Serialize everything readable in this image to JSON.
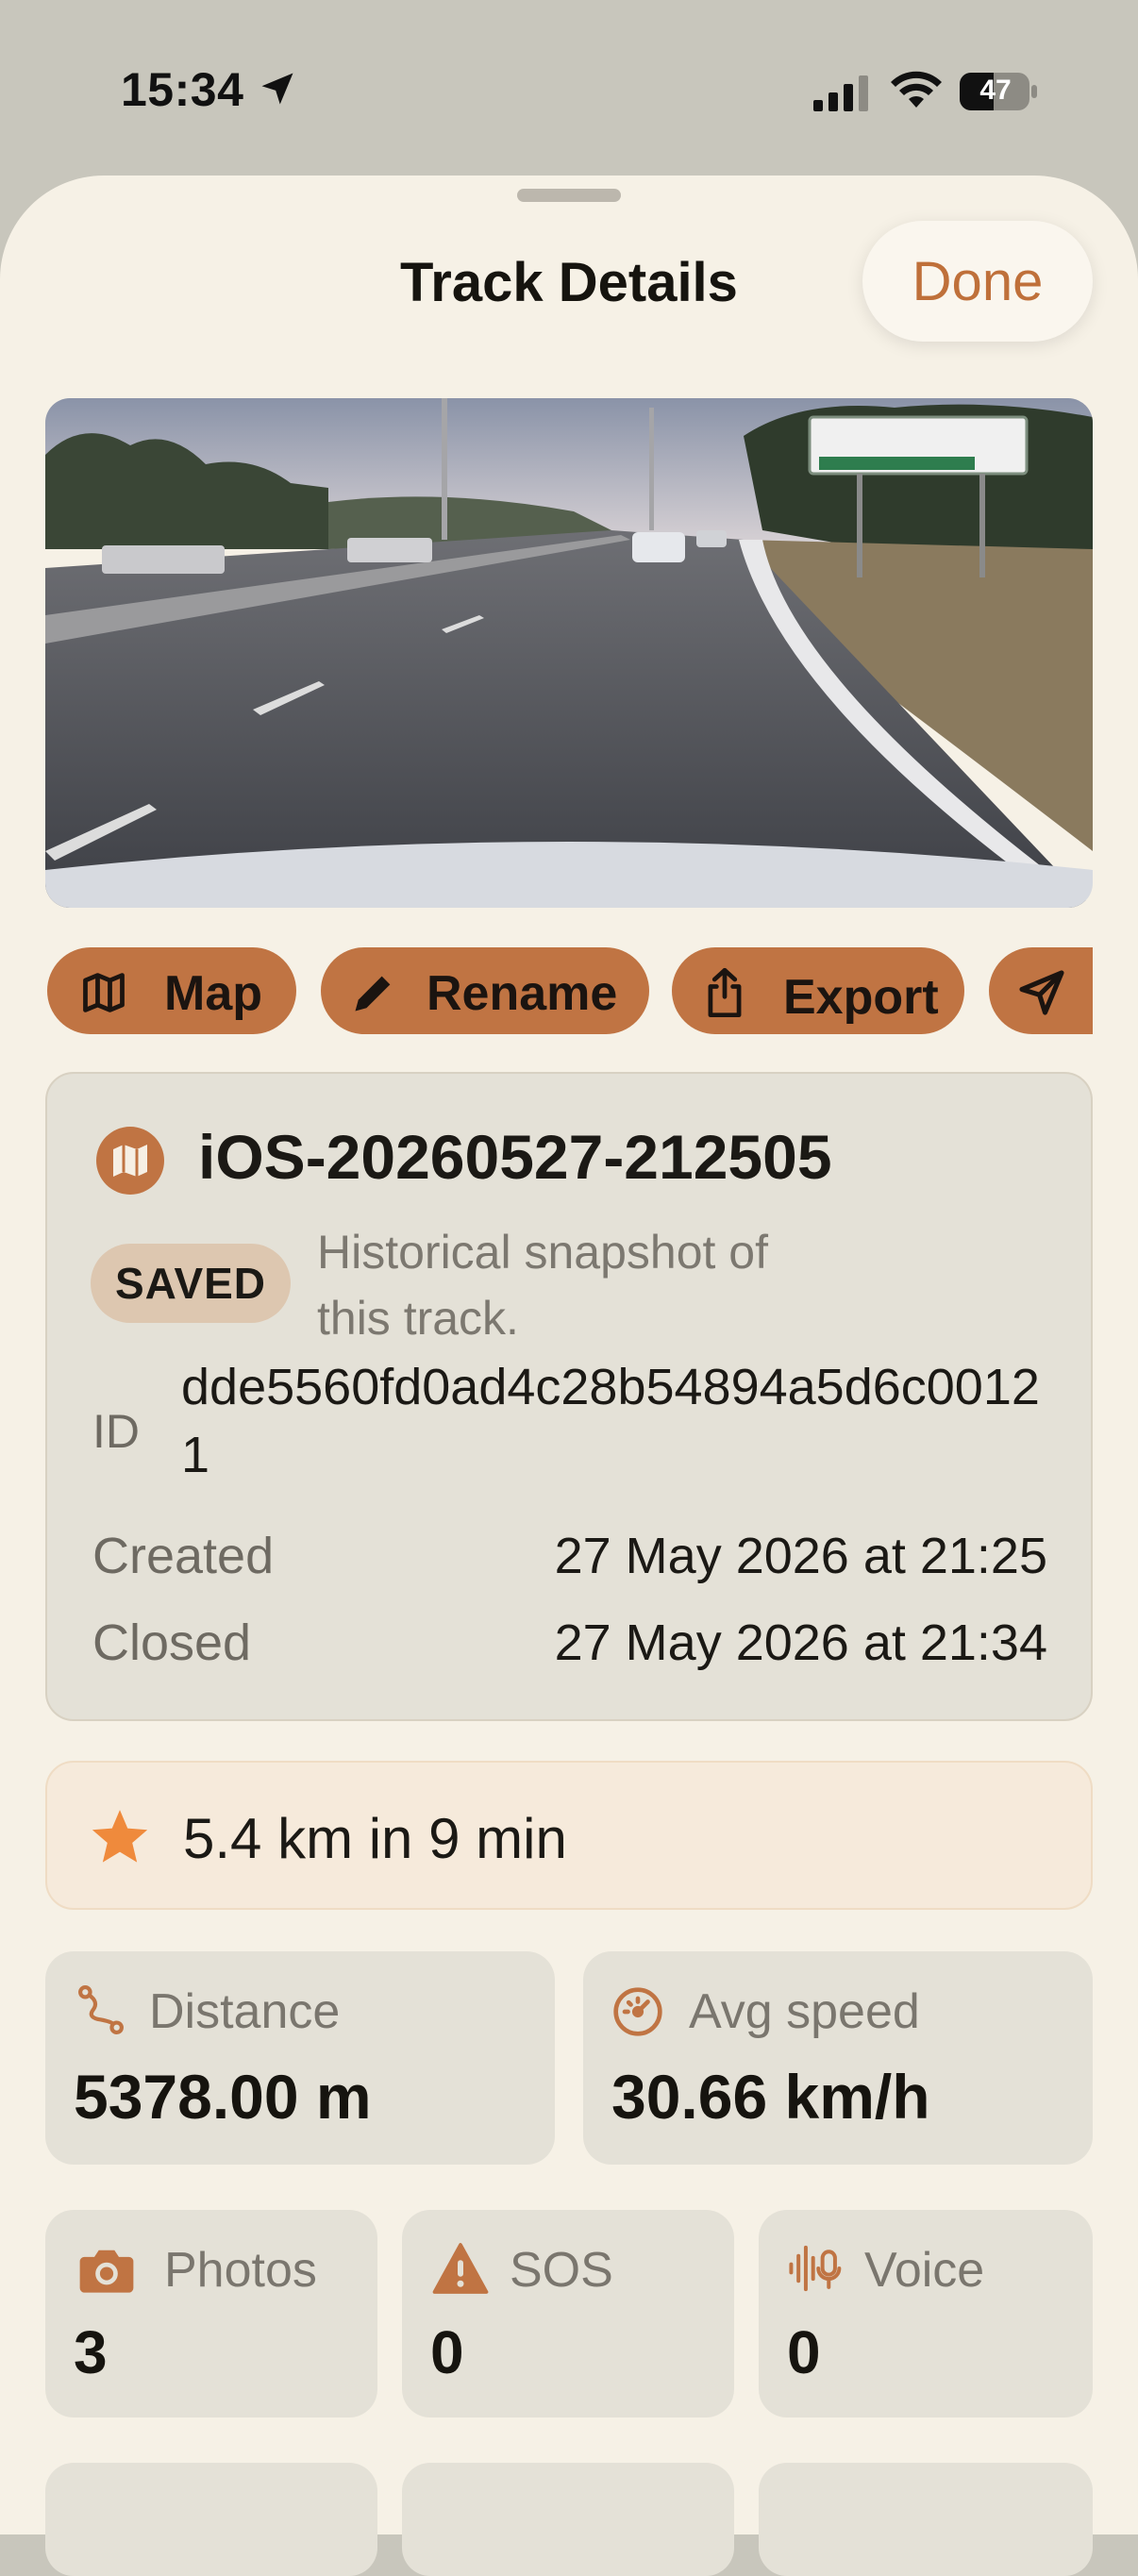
{
  "status_bar": {
    "time": "15:34",
    "battery": "47"
  },
  "header": {
    "title": "Track Details",
    "done_label": "Done"
  },
  "actions": [
    {
      "label": "Map",
      "icon": "map-icon"
    },
    {
      "label": "Rename",
      "icon": "pencil-icon"
    },
    {
      "label": "Export",
      "icon": "share-icon"
    },
    {
      "label": "",
      "icon": "send-icon"
    }
  ],
  "track": {
    "name": "iOS-20260527-212505",
    "badge": "SAVED",
    "badge_desc": "Historical snapshot of this track.",
    "id_label": "ID",
    "id_value": "dde5560fd0ad4c28b54894a5d6c00121",
    "created_label": "Created",
    "created_value": "27 May 2026 at 21:25",
    "closed_label": "Closed",
    "closed_value": "27 May 2026 at 21:34"
  },
  "summary": {
    "text": "5.4 km in 9 min"
  },
  "stats": {
    "distance": {
      "label": "Distance",
      "value": "5378.00 m"
    },
    "avg_speed": {
      "label": "Avg speed",
      "value": "30.66 km/h"
    },
    "photos": {
      "label": "Photos",
      "value": "3"
    },
    "sos": {
      "label": "SOS",
      "value": "0"
    },
    "voice": {
      "label": "Voice",
      "value": "0"
    }
  },
  "colors": {
    "accent": "#bf703a",
    "chip": "#c07443",
    "star": "#ef8a3c",
    "background": "#f6f1e6"
  }
}
